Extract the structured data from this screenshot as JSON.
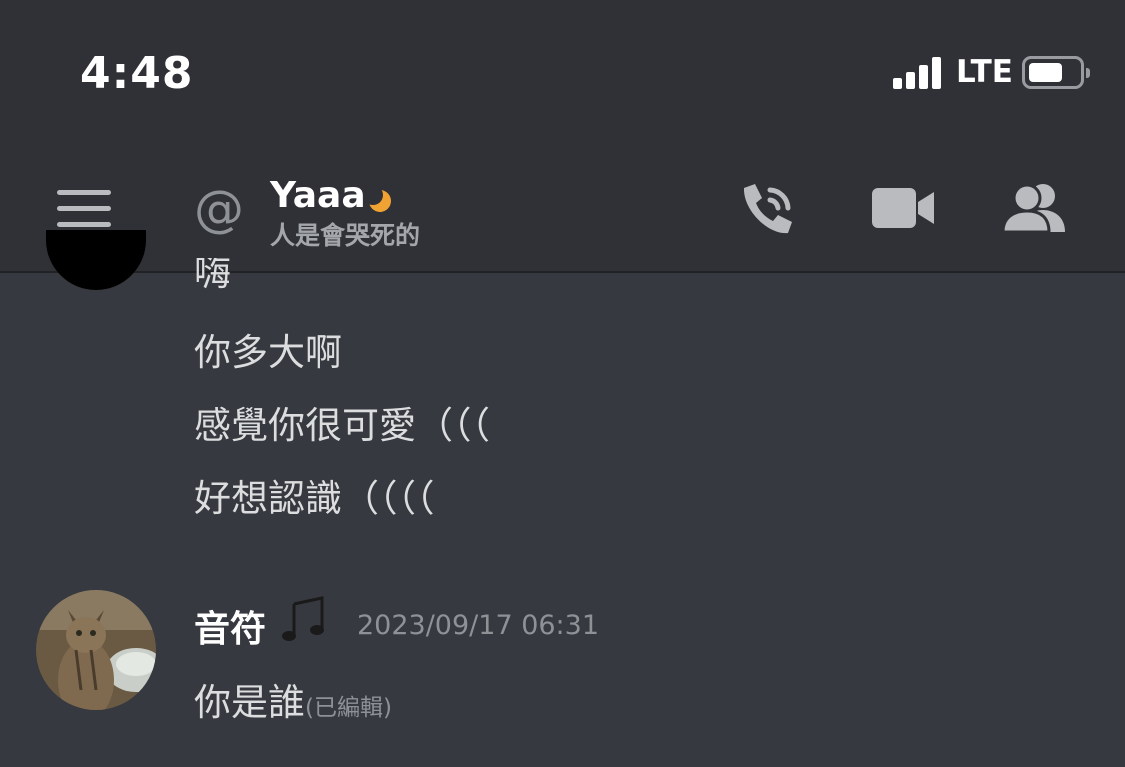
{
  "status_bar": {
    "time": "4:48",
    "network": "LTE"
  },
  "header": {
    "title": "Yaaa",
    "subtitle": "人是會哭死的",
    "icons": [
      "menu-icon",
      "at-icon",
      "moon-icon",
      "call-icon",
      "video-icon",
      "members-icon"
    ]
  },
  "messages": {
    "partial_line": "嗨",
    "lines": [
      "你多大啊",
      "感覺你很可愛（（（",
      "好想認識（（（（"
    ]
  },
  "message2": {
    "username": "音符",
    "timestamp": "2023/09/17 06:31",
    "text": "你是誰",
    "edited": "(已編輯)"
  },
  "colors": {
    "background": "#36393f",
    "header": "#2f3136",
    "status_moon": "#f0a232"
  }
}
